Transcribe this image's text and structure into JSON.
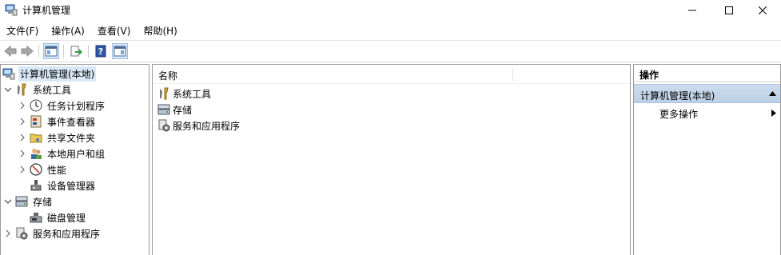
{
  "window": {
    "title": "计算机管理",
    "minimize_icon": "minimize-icon",
    "maximize_icon": "maximize-icon",
    "close_icon": "close-icon"
  },
  "menu": {
    "items": [
      "文件(F)",
      "操作(A)",
      "查看(V)",
      "帮助(H)"
    ]
  },
  "toolbar": {
    "buttons": [
      "back-arrow-icon",
      "forward-arrow-icon",
      "show-hide-tree-icon",
      "export-list-icon",
      "help-icon",
      "show-hide-action-pane-icon"
    ]
  },
  "tree": {
    "root": "计算机管理(本地)",
    "system_tools": "系统工具",
    "task_scheduler": "任务计划程序",
    "event_viewer": "事件查看器",
    "shared_folders": "共享文件夹",
    "local_users": "本地用户和组",
    "performance": "性能",
    "device_manager": "设备管理器",
    "storage": "存储",
    "disk_management": "磁盘管理",
    "services_apps": "服务和应用程序"
  },
  "center": {
    "column_name": "名称",
    "items": [
      "系统工具",
      "存储",
      "服务和应用程序"
    ]
  },
  "actions": {
    "header": "操作",
    "section": "计算机管理(本地)",
    "more": "更多操作"
  }
}
